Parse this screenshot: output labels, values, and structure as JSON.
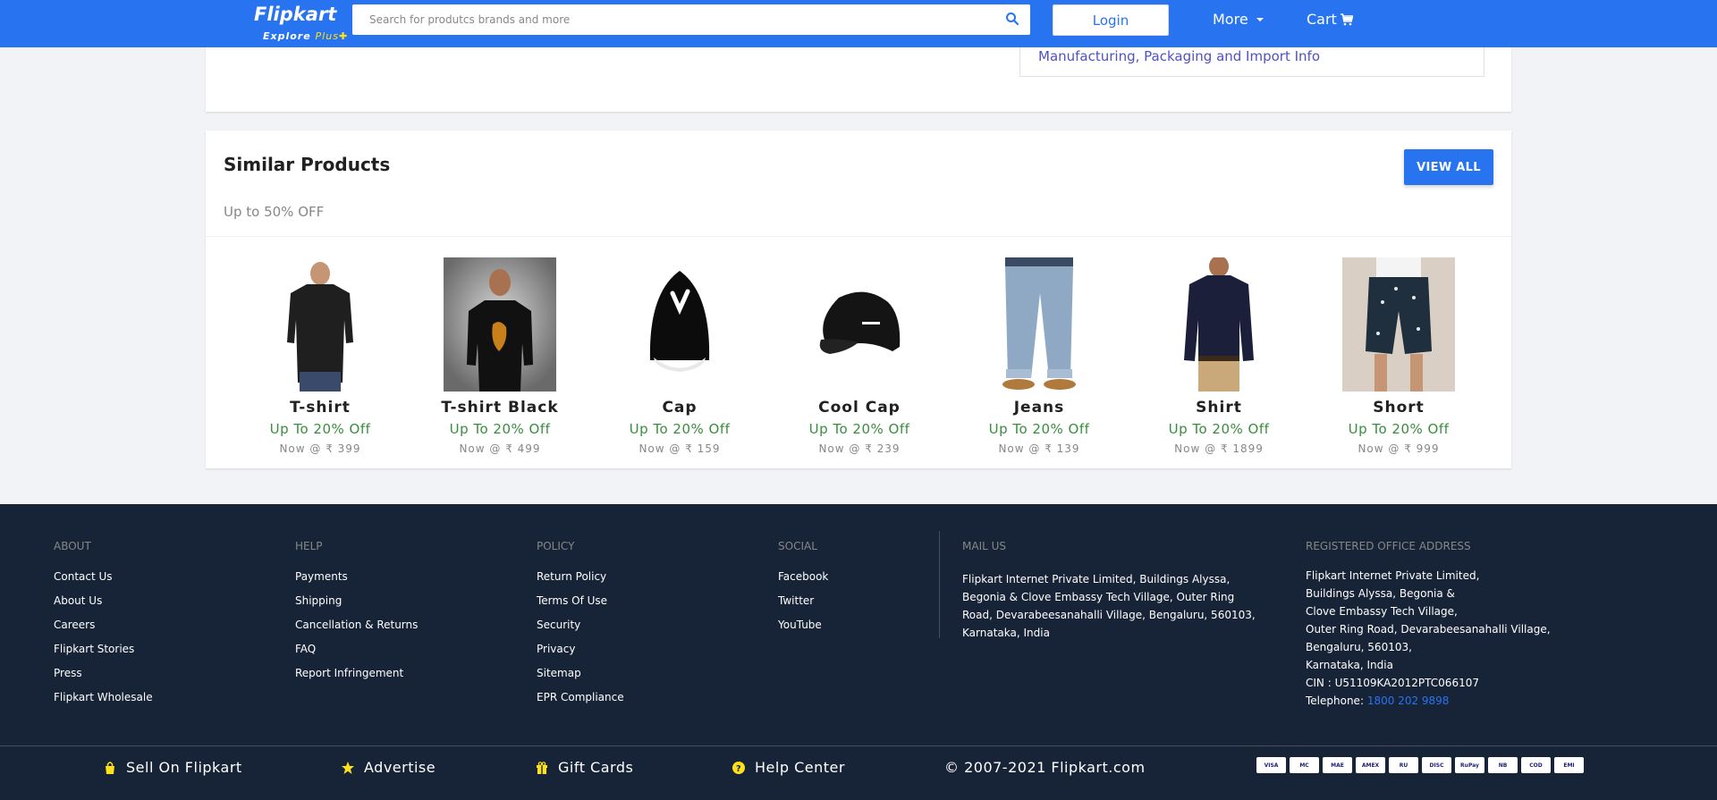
{
  "header": {
    "logo_name": "Flipkart",
    "logo_explore": "Explore",
    "logo_plus": "Plus",
    "search_placeholder": "Search for produtcs brands and more",
    "login_label": "Login",
    "more_label": "More",
    "cart_label": "Cart"
  },
  "top_card": {
    "mfg_link": "Manufacturing, Packaging and Import Info"
  },
  "similar": {
    "title": "Similar Products",
    "subtitle": "Up to 50% OFF",
    "view_all": "VIEW ALL",
    "products": [
      {
        "name": "T-shirt",
        "offer": "Up To 20% Off",
        "price": "Now @ ₹ 399"
      },
      {
        "name": "T-shirt Black",
        "offer": "Up To 20% Off",
        "price": "Now @ ₹ 499"
      },
      {
        "name": "Cap",
        "offer": "Up To 20% Off",
        "price": "Now @ ₹ 159"
      },
      {
        "name": "Cool Cap",
        "offer": "Up To 20% Off",
        "price": "Now @ ₹ 239"
      },
      {
        "name": "Jeans",
        "offer": "Up To 20% Off",
        "price": "Now @ ₹ 139"
      },
      {
        "name": "Shirt",
        "offer": "Up To 20% Off",
        "price": "Now @ ₹ 1899"
      },
      {
        "name": "Short",
        "offer": "Up To 20% Off",
        "price": "Now @ ₹ 999"
      }
    ]
  },
  "footer": {
    "about": {
      "head": "ABOUT",
      "links": [
        "Contact Us",
        "About Us",
        "Careers",
        "Flipkart Stories",
        "Press",
        "Flipkart Wholesale"
      ]
    },
    "help": {
      "head": "HELP",
      "links": [
        "Payments",
        "Shipping",
        "Cancellation & Returns",
        "FAQ",
        "Report Infringement"
      ]
    },
    "policy": {
      "head": "POLICY",
      "links": [
        "Return Policy",
        "Terms Of Use",
        "Security",
        "Privacy",
        "Sitemap",
        "EPR Compliance"
      ]
    },
    "social": {
      "head": "SOCIAL",
      "links": [
        "Facebook",
        "Twitter",
        "YouTube"
      ]
    },
    "mail": {
      "head": "MAIL US",
      "lines": [
        "Flipkart Internet Private Limited, Buildings Alyssa,",
        "Begonia & Clove Embassy Tech Village, Outer Ring",
        "Road, Devarabeesanahalli Village, Bengaluru, 560103,",
        "Karnataka, India"
      ]
    },
    "office": {
      "head": "REGISTERED OFFICE ADDRESS",
      "lines": [
        "Flipkart Internet Private Limited,",
        "Buildings Alyssa, Begonia &",
        "Clove Embassy Tech Village,",
        "Outer Ring Road, Devarabeesanahalli Village,",
        "Bengaluru, 560103,",
        "Karnataka, India",
        "CIN : U51109KA2012PTC066107"
      ],
      "tel_label": "Telephone:",
      "tel_number": "1800 202 9898"
    },
    "bottom": {
      "sell": "Sell On Flipkart",
      "advertise": "Advertise",
      "gift": "Gift Cards",
      "help": "Help Center",
      "copyright": "© 2007-2021 Flipkart.com"
    },
    "payments": [
      "VISA",
      "MC",
      "MAE",
      "AMEX",
      "RU",
      "DISC",
      "RuPay",
      "NB",
      "COD",
      "EMI"
    ]
  },
  "colors": {
    "brand": "#2874f0",
    "offer_green": "#388e3c",
    "footer_bg": "#172337",
    "plus_yellow": "#ffe11b"
  }
}
